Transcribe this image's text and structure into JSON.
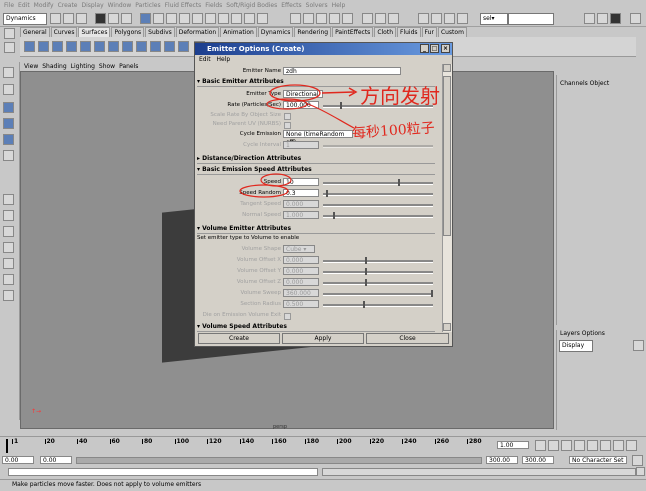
{
  "menubar": {
    "items": [
      "File",
      "Edit",
      "Modify",
      "Create",
      "Display",
      "Window",
      "Particles",
      "Fluid Effects",
      "Fields",
      "Soft/Rigid Bodies",
      "Effects",
      "Solvers",
      "Help"
    ]
  },
  "status": {
    "menuset": "Dynamics",
    "sel_label": "sel▾"
  },
  "shelf": {
    "tabs": [
      "General",
      "Curves",
      "Surfaces",
      "Polygons",
      "Subdivs",
      "Deformation",
      "Animation",
      "Dynamics",
      "Rendering",
      "PaintEffects",
      "Cloth",
      "Fluids",
      "Fur",
      "Custom"
    ],
    "active": 2
  },
  "viewport": {
    "menus": [
      "View",
      "Shading",
      "Lighting",
      "Show",
      "Panels"
    ],
    "camera_label": "persp"
  },
  "dialog": {
    "title": "Emitter Options (Create)",
    "menus": [
      "Edit",
      "Help"
    ],
    "emitter_name_label": "Emitter Name",
    "emitter_name_value": "zdh",
    "sections": {
      "basic": "Basic Emitter Attributes",
      "distance": "Distance/Direction Attributes",
      "speed": "Basic Emission Speed Attributes",
      "volume": "Volume Emitter Attributes",
      "volume_speed": "Volume Speed Attributes"
    },
    "emitter_type_label": "Emitter Type",
    "emitter_type_value": "Directional",
    "rate_label": "Rate (Particles/Sec)",
    "rate_value": "100.000",
    "scale_rate_label": "Scale Rate By Object Size",
    "need_parent_uv_label": "Need Parent UV (NURBS)",
    "cycle_emission_label": "Cycle Emission",
    "cycle_emission_value": "None (timeRandom off)",
    "cycle_interval_label": "Cycle Interval",
    "cycle_interval_value": "1",
    "speed_label": "Speed",
    "speed_value": "10",
    "speed_random_label": "Speed Random",
    "speed_random_value": "0.3",
    "tangent_speed_label": "Tangent Speed",
    "tangent_speed_value": "0.000",
    "normal_speed_label": "Normal Speed",
    "normal_speed_value": "1.000",
    "volume_note": "Set emitter type to Volume to enable",
    "volume_shape_label": "Volume Shape",
    "volume_shape_value": "Cube",
    "volume_offset_x_label": "Volume Offset X",
    "volume_offset_x_value": "0.000",
    "volume_offset_y_label": "Volume Offset Y",
    "volume_offset_y_value": "0.000",
    "volume_offset_z_label": "Volume Offset Z",
    "volume_offset_z_value": "0.000",
    "volume_sweep_label": "Volume Sweep",
    "volume_sweep_value": "360.000",
    "section_radius_label": "Section Radius",
    "section_radius_value": "0.500",
    "die_on_exit_label": "Die on Emission Volume Exit",
    "buttons": {
      "create": "Create",
      "apply": "Apply",
      "close": "Close"
    }
  },
  "annotations": {
    "direction": "方向发射",
    "per_second": "每秒100粒子"
  },
  "channel_box": {
    "header": "Channels  Object"
  },
  "layers": {
    "header": "Layers  Options",
    "display": "Display"
  },
  "timeline": {
    "ticks": [
      "1",
      "20",
      "40",
      "60",
      "80",
      "100",
      "120",
      "140",
      "160",
      "180",
      "200",
      "220",
      "240",
      "260",
      "280"
    ],
    "current": "1.00"
  },
  "range": {
    "start": "0.00",
    "start2": "0.00",
    "end": "300.00",
    "end2": "300.00",
    "char_set": "No Character Set"
  },
  "help_line": "Make particles move faster. Does not apply to volume emitters",
  "colors": {
    "annotation": "#e0281e",
    "title_start": "#1c3e8e",
    "title_end": "#6a9be0",
    "viewport": "#8f8f8f"
  }
}
